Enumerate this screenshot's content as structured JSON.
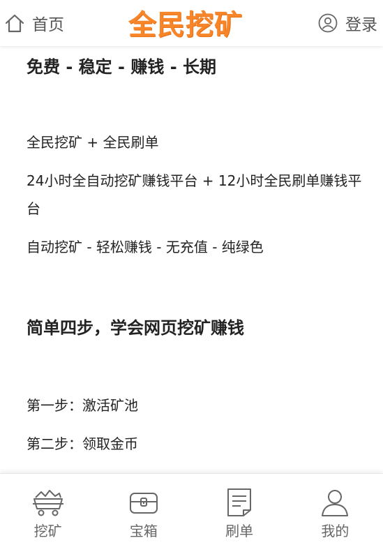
{
  "header": {
    "home_label": "首页",
    "logo_text": "全民挖矿",
    "login_label": "登录",
    "accent_color": "#f7862a"
  },
  "main": {
    "heading1": "免费 - 稳定 - 赚钱 - 长期",
    "line1": "全民挖矿 + 全民刷单",
    "line2": "24小时全自动挖矿赚钱平台 + 12小时全民刷单赚钱平台",
    "line3": "自动挖矿 - 轻松赚钱 - 无充值 - 纯绿色",
    "heading2": "简单四步，学会网页挖矿赚钱",
    "step1": "第一步：激活矿池",
    "step2": "第二步：领取金币"
  },
  "tabbar": {
    "items": [
      {
        "label": "挖矿",
        "icon": "mining-cart-icon"
      },
      {
        "label": "宝箱",
        "icon": "treasure-chest-icon"
      },
      {
        "label": "刷单",
        "icon": "document-icon"
      },
      {
        "label": "我的",
        "icon": "user-icon"
      }
    ]
  }
}
